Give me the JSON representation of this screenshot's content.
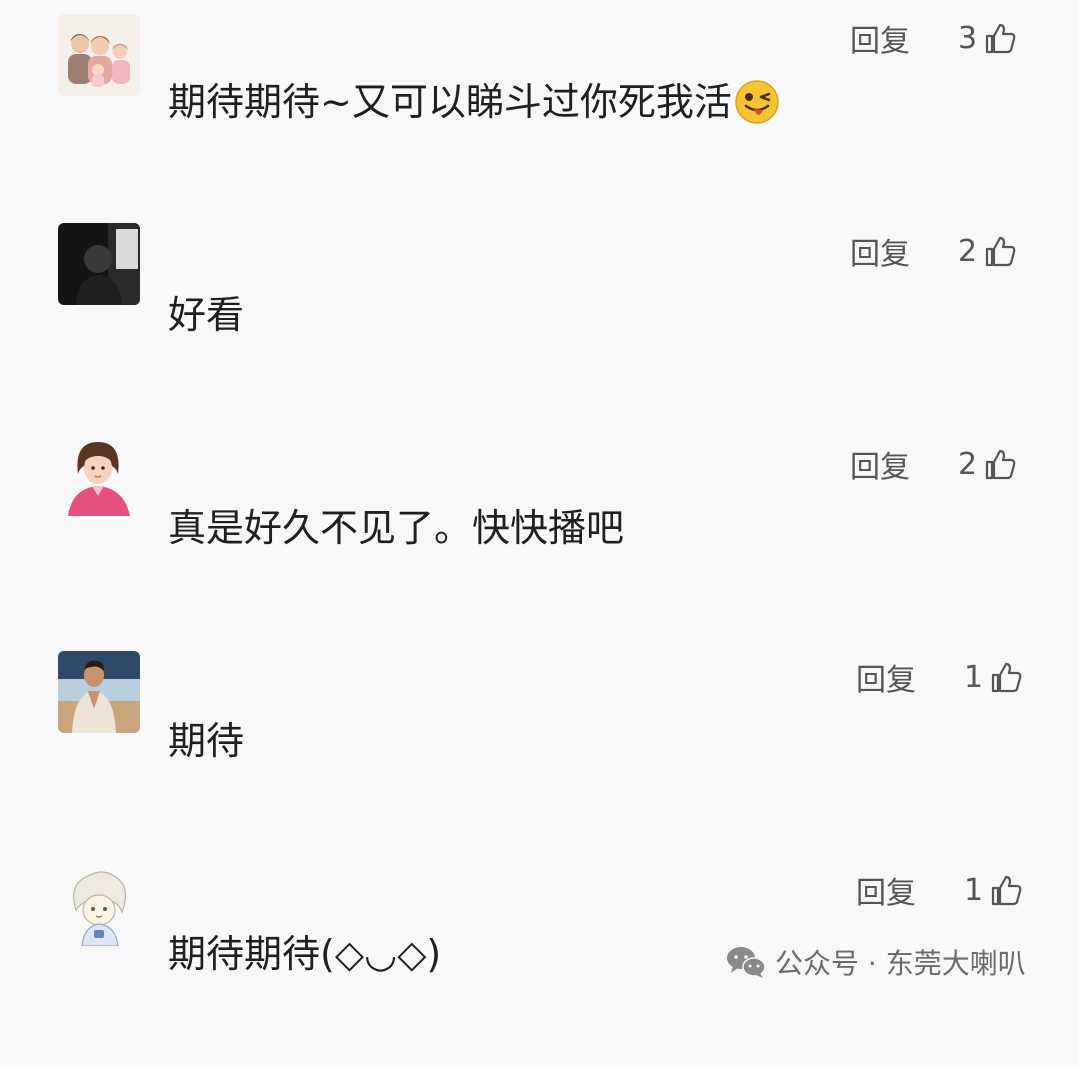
{
  "comments": [
    {
      "avatar": "family-avatar-icon",
      "text": "期待期待~又可以睇斗过你死我活",
      "emoji": "winking-tongue-emoji-icon",
      "reply_label": "回复",
      "likes": "3"
    },
    {
      "avatar": "dark-silhouette-avatar-icon",
      "text": "好看",
      "reply_label": "回复",
      "likes": "2"
    },
    {
      "avatar": "girl-pink-jacket-avatar-icon",
      "text": "真是好久不见了。快快播吧",
      "reply_label": "回复",
      "likes": "2"
    },
    {
      "avatar": "man-seaside-avatar-icon",
      "text": "期待",
      "reply_label": "回复",
      "likes": "1"
    },
    {
      "avatar": "sketch-character-avatar-icon",
      "text": "期待期待(◇◡◇)",
      "reply_label": "回复",
      "likes": "1"
    }
  ],
  "icons": {
    "like": "thumbs-up-icon",
    "watermark": "wechat-icon"
  },
  "watermark": {
    "text": "公众号 · 东莞大喇叭"
  },
  "colors": {
    "background": "#f8f8fa",
    "text": "#1f1f1f",
    "meta": "#555555"
  }
}
